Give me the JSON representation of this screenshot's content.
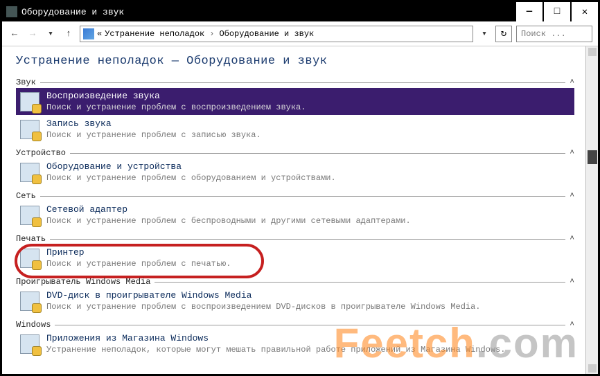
{
  "window": {
    "title": "Оборудование и звук"
  },
  "nav": {
    "crumb_prefix": "«",
    "crumb1": "Устранение неполадок",
    "crumb2": "Оборудование и звук",
    "search_placeholder": "Поиск ..."
  },
  "page_title": "Устранение неполадок — Оборудование и звук",
  "groups": [
    {
      "label": "Звук",
      "items": [
        {
          "title": "Воспроизведение звука",
          "desc": "Поиск и устранение проблем с воспроизведением звука.",
          "selected": true
        },
        {
          "title": "Запись звука",
          "desc": "Поиск и устранение проблем с записью звука."
        }
      ]
    },
    {
      "label": "Устройство",
      "items": [
        {
          "title": "Оборудование и устройства",
          "desc": "Поиск и устранение проблем с оборудованием и устройствами."
        }
      ]
    },
    {
      "label": "Сеть",
      "items": [
        {
          "title": "Сетевой адаптер",
          "desc": "Поиск и устранение проблем с беспроводными и другими сетевыми адаптерами."
        }
      ]
    },
    {
      "label": "Печать",
      "items": [
        {
          "title": "Принтер",
          "desc": "Поиск и устранение проблем с печатью.",
          "highlighted": true
        }
      ]
    },
    {
      "label": "Проигрыватель Windows Media",
      "items": [
        {
          "title": "DVD-диск в проигрывателе Windows Media",
          "desc": "Поиск и устранение проблем с воспроизведением DVD-дисков в проигрывателе Windows Media."
        }
      ]
    },
    {
      "label": "Windows",
      "items": [
        {
          "title": "Приложения из Магазина Windows",
          "desc": "Устранение неполадок, которые могут мешать правильной работе приложений из Магазина Windows."
        }
      ]
    }
  ],
  "watermark": {
    "a": "Feetch",
    "b": ".com"
  }
}
